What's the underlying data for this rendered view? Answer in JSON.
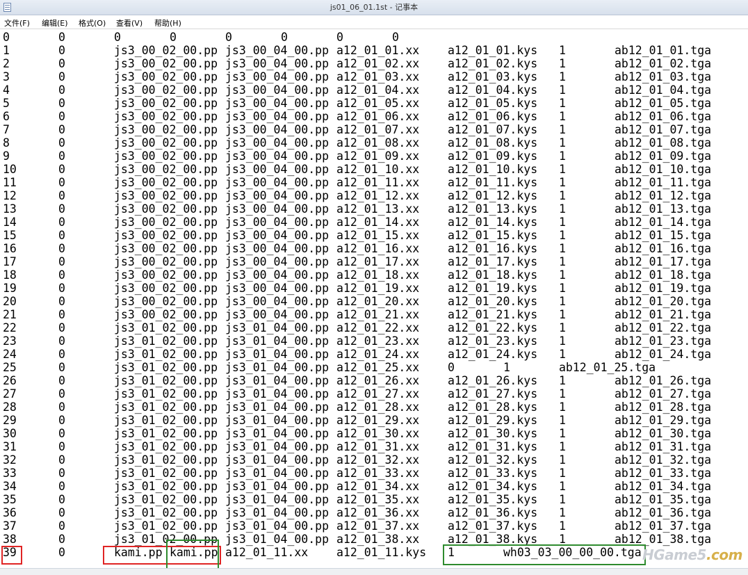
{
  "window": {
    "title": "js01_06_01.1st - 记事本"
  },
  "menu": [
    {
      "label": "文件(F)"
    },
    {
      "label": "编辑(E)"
    },
    {
      "label": "格式(O)"
    },
    {
      "label": "查看(V)"
    },
    {
      "label": "帮助(H)"
    }
  ],
  "rows": [
    [
      "0",
      "0",
      "0",
      "0",
      "0",
      "0",
      "0",
      "0"
    ],
    [
      "1",
      "0",
      "js3_00_02_00.pp",
      "js3_00_04_00.pp",
      "a12_01_01.xx",
      "a12_01_01.kys",
      "1",
      "ab12_01_01.tga"
    ],
    [
      "2",
      "0",
      "js3_00_02_00.pp",
      "js3_00_04_00.pp",
      "a12_01_02.xx",
      "a12_01_02.kys",
      "1",
      "ab12_01_02.tga"
    ],
    [
      "3",
      "0",
      "js3_00_02_00.pp",
      "js3_00_04_00.pp",
      "a12_01_03.xx",
      "a12_01_03.kys",
      "1",
      "ab12_01_03.tga"
    ],
    [
      "4",
      "0",
      "js3_00_02_00.pp",
      "js3_00_04_00.pp",
      "a12_01_04.xx",
      "a12_01_04.kys",
      "1",
      "ab12_01_04.tga"
    ],
    [
      "5",
      "0",
      "js3_00_02_00.pp",
      "js3_00_04_00.pp",
      "a12_01_05.xx",
      "a12_01_05.kys",
      "1",
      "ab12_01_05.tga"
    ],
    [
      "6",
      "0",
      "js3_00_02_00.pp",
      "js3_00_04_00.pp",
      "a12_01_06.xx",
      "a12_01_06.kys",
      "1",
      "ab12_01_06.tga"
    ],
    [
      "7",
      "0",
      "js3_00_02_00.pp",
      "js3_00_04_00.pp",
      "a12_01_07.xx",
      "a12_01_07.kys",
      "1",
      "ab12_01_07.tga"
    ],
    [
      "8",
      "0",
      "js3_00_02_00.pp",
      "js3_00_04_00.pp",
      "a12_01_08.xx",
      "a12_01_08.kys",
      "1",
      "ab12_01_08.tga"
    ],
    [
      "9",
      "0",
      "js3_00_02_00.pp",
      "js3_00_04_00.pp",
      "a12_01_09.xx",
      "a12_01_09.kys",
      "1",
      "ab12_01_09.tga"
    ],
    [
      "10",
      "0",
      "js3_00_02_00.pp",
      "js3_00_04_00.pp",
      "a12_01_10.xx",
      "a12_01_10.kys",
      "1",
      "ab12_01_10.tga"
    ],
    [
      "11",
      "0",
      "js3_00_02_00.pp",
      "js3_00_04_00.pp",
      "a12_01_11.xx",
      "a12_01_11.kys",
      "1",
      "ab12_01_11.tga"
    ],
    [
      "12",
      "0",
      "js3_00_02_00.pp",
      "js3_00_04_00.pp",
      "a12_01_12.xx",
      "a12_01_12.kys",
      "1",
      "ab12_01_12.tga"
    ],
    [
      "13",
      "0",
      "js3_00_02_00.pp",
      "js3_00_04_00.pp",
      "a12_01_13.xx",
      "a12_01_13.kys",
      "1",
      "ab12_01_13.tga"
    ],
    [
      "14",
      "0",
      "js3_00_02_00.pp",
      "js3_00_04_00.pp",
      "a12_01_14.xx",
      "a12_01_14.kys",
      "1",
      "ab12_01_14.tga"
    ],
    [
      "15",
      "0",
      "js3_00_02_00.pp",
      "js3_00_04_00.pp",
      "a12_01_15.xx",
      "a12_01_15.kys",
      "1",
      "ab12_01_15.tga"
    ],
    [
      "16",
      "0",
      "js3_00_02_00.pp",
      "js3_00_04_00.pp",
      "a12_01_16.xx",
      "a12_01_16.kys",
      "1",
      "ab12_01_16.tga"
    ],
    [
      "17",
      "0",
      "js3_00_02_00.pp",
      "js3_00_04_00.pp",
      "a12_01_17.xx",
      "a12_01_17.kys",
      "1",
      "ab12_01_17.tga"
    ],
    [
      "18",
      "0",
      "js3_00_02_00.pp",
      "js3_00_04_00.pp",
      "a12_01_18.xx",
      "a12_01_18.kys",
      "1",
      "ab12_01_18.tga"
    ],
    [
      "19",
      "0",
      "js3_00_02_00.pp",
      "js3_00_04_00.pp",
      "a12_01_19.xx",
      "a12_01_19.kys",
      "1",
      "ab12_01_19.tga"
    ],
    [
      "20",
      "0",
      "js3_00_02_00.pp",
      "js3_00_04_00.pp",
      "a12_01_20.xx",
      "a12_01_20.kys",
      "1",
      "ab12_01_20.tga"
    ],
    [
      "21",
      "0",
      "js3_00_02_00.pp",
      "js3_00_04_00.pp",
      "a12_01_21.xx",
      "a12_01_21.kys",
      "1",
      "ab12_01_21.tga"
    ],
    [
      "22",
      "0",
      "js3_01_02_00.pp",
      "js3_01_04_00.pp",
      "a12_01_22.xx",
      "a12_01_22.kys",
      "1",
      "ab12_01_22.tga"
    ],
    [
      "23",
      "0",
      "js3_01_02_00.pp",
      "js3_01_04_00.pp",
      "a12_01_23.xx",
      "a12_01_23.kys",
      "1",
      "ab12_01_23.tga"
    ],
    [
      "24",
      "0",
      "js3_01_02_00.pp",
      "js3_01_04_00.pp",
      "a12_01_24.xx",
      "a12_01_24.kys",
      "1",
      "ab12_01_24.tga"
    ],
    [
      "25",
      "0",
      "js3_01_02_00.pp",
      "js3_01_04_00.pp",
      "a12_01_25.xx",
      "0",
      "1",
      "ab12_01_25.tga"
    ],
    [
      "26",
      "0",
      "js3_01_02_00.pp",
      "js3_01_04_00.pp",
      "a12_01_26.xx",
      "a12_01_26.kys",
      "1",
      "ab12_01_26.tga"
    ],
    [
      "27",
      "0",
      "js3_01_02_00.pp",
      "js3_01_04_00.pp",
      "a12_01_27.xx",
      "a12_01_27.kys",
      "1",
      "ab12_01_27.tga"
    ],
    [
      "28",
      "0",
      "js3_01_02_00.pp",
      "js3_01_04_00.pp",
      "a12_01_28.xx",
      "a12_01_28.kys",
      "1",
      "ab12_01_28.tga"
    ],
    [
      "29",
      "0",
      "js3_01_02_00.pp",
      "js3_01_04_00.pp",
      "a12_01_29.xx",
      "a12_01_29.kys",
      "1",
      "ab12_01_29.tga"
    ],
    [
      "30",
      "0",
      "js3_01_02_00.pp",
      "js3_01_04_00.pp",
      "a12_01_30.xx",
      "a12_01_30.kys",
      "1",
      "ab12_01_30.tga"
    ],
    [
      "31",
      "0",
      "js3_01_02_00.pp",
      "js3_01_04_00.pp",
      "a12_01_31.xx",
      "a12_01_31.kys",
      "1",
      "ab12_01_31.tga"
    ],
    [
      "32",
      "0",
      "js3_01_02_00.pp",
      "js3_01_04_00.pp",
      "a12_01_32.xx",
      "a12_01_32.kys",
      "1",
      "ab12_01_32.tga"
    ],
    [
      "33",
      "0",
      "js3_01_02_00.pp",
      "js3_01_04_00.pp",
      "a12_01_33.xx",
      "a12_01_33.kys",
      "1",
      "ab12_01_33.tga"
    ],
    [
      "34",
      "0",
      "js3_01_02_00.pp",
      "js3_01_04_00.pp",
      "a12_01_34.xx",
      "a12_01_34.kys",
      "1",
      "ab12_01_34.tga"
    ],
    [
      "35",
      "0",
      "js3_01_02_00.pp",
      "js3_01_04_00.pp",
      "a12_01_35.xx",
      "a12_01_35.kys",
      "1",
      "ab12_01_35.tga"
    ],
    [
      "36",
      "0",
      "js3_01_02_00.pp",
      "js3_01_04_00.pp",
      "a12_01_36.xx",
      "a12_01_36.kys",
      "1",
      "ab12_01_36.tga"
    ],
    [
      "37",
      "0",
      "js3_01_02_00.pp",
      "js3_01_04_00.pp",
      "a12_01_37.xx",
      "a12_01_37.kys",
      "1",
      "ab12_01_37.tga"
    ],
    [
      "38",
      "0",
      "js3_01_02_00.pp",
      "js3_01_04_00.pp",
      "a12_01_38.xx",
      "a12_01_38.kys",
      "1",
      "ab12_01_38.tga"
    ],
    [
      "39",
      "0",
      "kami.pp",
      "kami.pp",
      "a12_01_11.xx",
      "a12_01_11.kys",
      "1",
      "wh03_03_00_00_00.tga"
    ]
  ],
  "highlight_colors": {
    "red": "#e02424",
    "green": "#2e8b2e"
  },
  "watermark": {
    "brand": "HGame5",
    "suffix": ".com"
  }
}
